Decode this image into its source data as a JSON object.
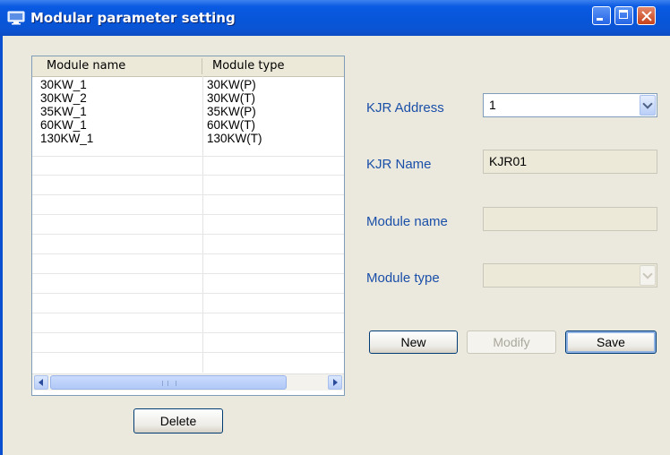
{
  "window": {
    "title": "Modular parameter setting"
  },
  "list": {
    "headers": [
      "Module name",
      "Module type"
    ],
    "rows": [
      [
        "30KW_1",
        "30KW(P)"
      ],
      [
        "30KW_2",
        "30KW(T)"
      ],
      [
        "35KW_1",
        "35KW(P)"
      ],
      [
        "60KW_1",
        "60KW(T)"
      ],
      [
        "130KW_1",
        "130KW(T)"
      ]
    ]
  },
  "buttons": {
    "delete": "Delete",
    "new": "New",
    "modify": "Modify",
    "save": "Save"
  },
  "form": {
    "kjr_address_label": "KJR Address",
    "kjr_address_value": "1",
    "kjr_name_label": "KJR Name",
    "kjr_name_value": "KJR01",
    "module_name_label": "Module name",
    "module_name_value": "",
    "module_type_label": "Module type",
    "module_type_value": ""
  },
  "colors": {
    "title_bar": "#0a5ae3",
    "label_blue": "#1a4fa8",
    "window_body": "#ebe9de"
  }
}
